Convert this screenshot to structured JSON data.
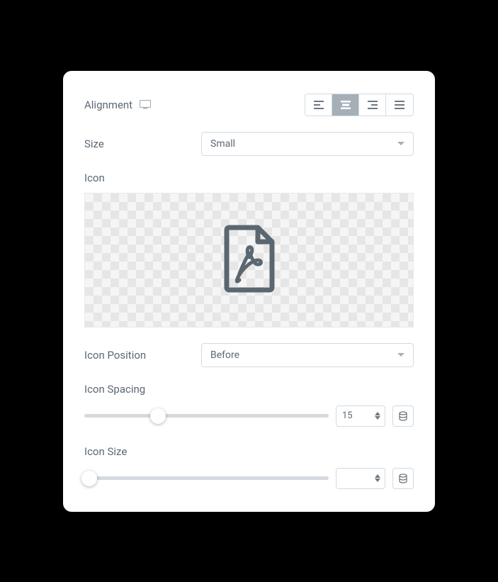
{
  "alignment": {
    "label": "Alignment",
    "selected": "center",
    "options": [
      "left",
      "center",
      "right",
      "justify"
    ]
  },
  "size": {
    "label": "Size",
    "value": "Small"
  },
  "icon": {
    "label": "Icon",
    "name": "pdf-file-icon"
  },
  "iconPosition": {
    "label": "Icon Position",
    "value": "Before"
  },
  "iconSpacing": {
    "label": "Icon Spacing",
    "value": "15",
    "percent": 30
  },
  "iconSize": {
    "label": "Icon Size",
    "value": "",
    "percent": 0
  }
}
